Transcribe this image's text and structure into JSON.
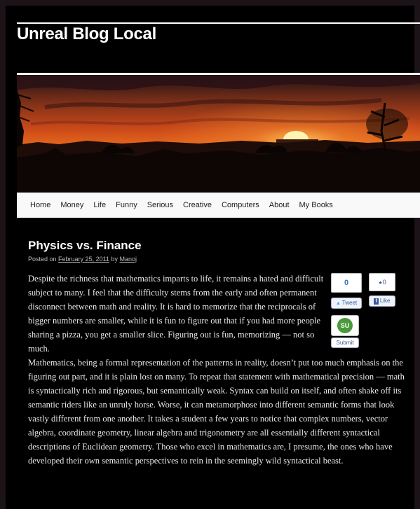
{
  "site": {
    "title": "Unreal Blog Local"
  },
  "nav": {
    "items": [
      {
        "label": "Home"
      },
      {
        "label": "Money"
      },
      {
        "label": "Life"
      },
      {
        "label": "Funny"
      },
      {
        "label": "Serious"
      },
      {
        "label": "Creative"
      },
      {
        "label": "Computers"
      },
      {
        "label": "About"
      },
      {
        "label": "My Books"
      }
    ]
  },
  "post": {
    "title": "Physics vs. Finance",
    "meta": {
      "posted_on": "Posted on",
      "date": "February 25, 2011",
      "by": "by",
      "author": "Manoj"
    },
    "paragraph1": "Despite the richness that mathematics imparts to life, it remains a hated and difficult subject to many. I feel that the difficulty stems from the early and often permanent disconnect between math and reality. It is hard to memorize that the reciprocals of bigger numbers are smaller, while it is fun to figure out that if you had more people sharing a pizza, you get a smaller slice. Figuring out is fun, memorizing — not so much.",
    "paragraph2": "Mathematics, being a formal representation of the patterns in reality, doesn’t put too much emphasis on the figuring out part, and it is plain lost on many. To repeat that statement with mathematical precision — math is syntactically rich and rigorous, but semantically weak. Syntax can build on itself, and often shake off its semantic riders like an unruly horse. Worse, it can metamorphose into different semantic forms that look vastly different from one another. It takes a student a few years to notice that complex numbers, vector algebra, coordinate geometry, linear algebra and trigonometry are all essentially different syntactical descriptions of Euclidean geometry. Those who excel in mathematics are, I presume, the ones who have developed their own semantic perspectives to rein in the seemingly wild syntactical beast."
  },
  "share": {
    "tweet": {
      "count": "0",
      "label": "Tweet"
    },
    "like": {
      "count": "0",
      "label": "Like"
    },
    "stumble": {
      "label": "Submit",
      "logo": "SU"
    }
  },
  "icons": {
    "tweet": "bird-icon",
    "like": "facebook-icon",
    "thumb": "thumbs-up-icon",
    "stumble": "stumbleupon-icon"
  },
  "colors": {
    "page_bg": "#000000",
    "outer_bg": "#1c1319",
    "nav_bg": "#f9f9f9",
    "link": "#2b78c5",
    "stumble_green": "#4a9a3b"
  }
}
